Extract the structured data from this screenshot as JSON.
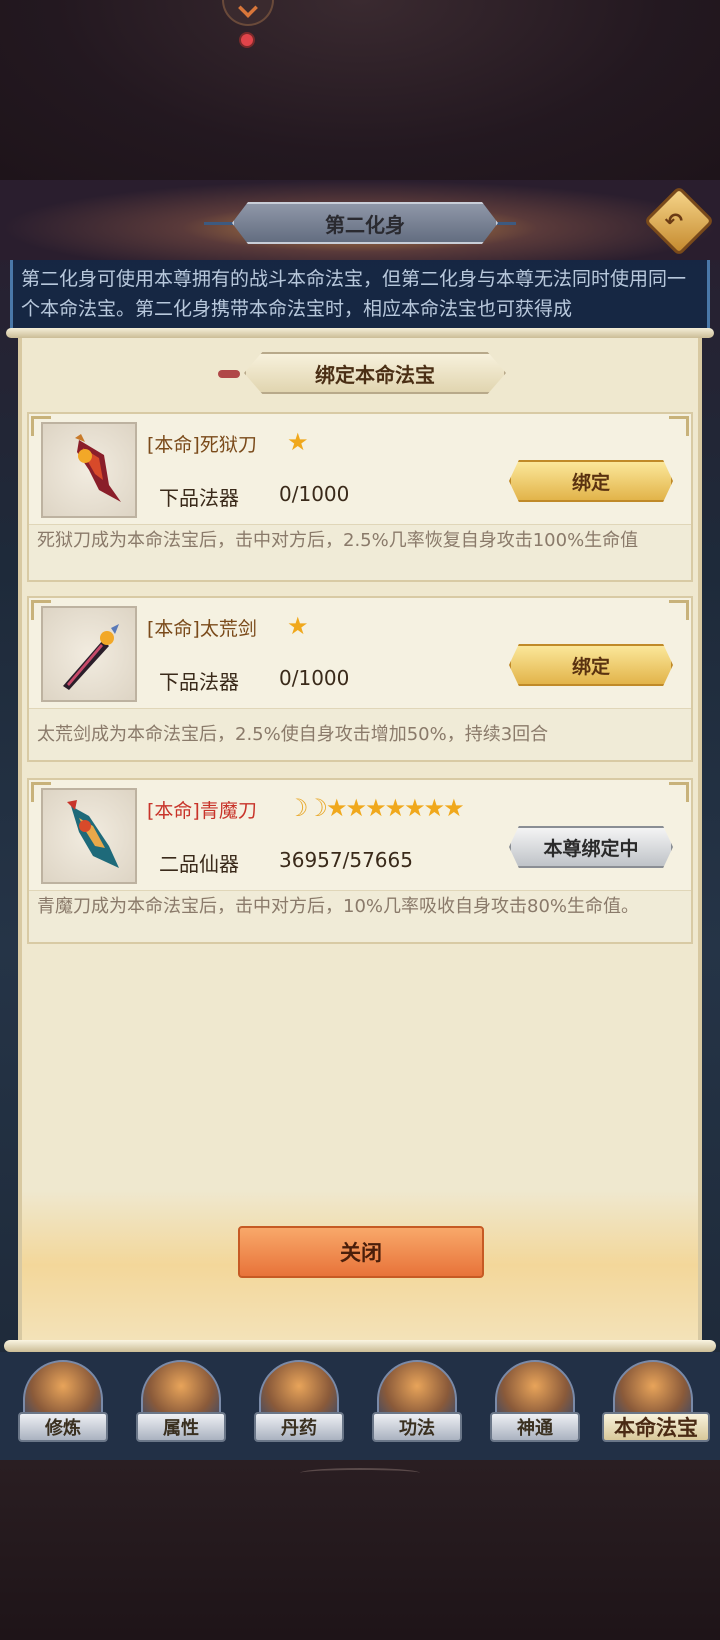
{
  "header": {
    "title": "第二化身"
  },
  "info": {
    "text": "第二化身可使用本尊拥有的战斗本命法宝，但第二化身与本尊无法同时使用同一个本命法宝。第二化身携带本命法宝时，相应本命法宝也可获得成"
  },
  "section": {
    "title": "绑定本命法宝"
  },
  "items": [
    {
      "name": "[本命]死狱刀",
      "stars": "★",
      "grade": "下品法器",
      "progress": "0/1000",
      "button": "绑定",
      "desc": "死狱刀成为本命法宝后，击中对方后，2.5%几率恢复自身攻击100%生命值"
    },
    {
      "name": "[本命]太荒剑",
      "stars": "★",
      "grade": "下品法器",
      "progress": "0/1000",
      "button": "绑定",
      "desc": "太荒剑成为本命法宝后，2.5%使自身攻击增加50%，持续3回合"
    },
    {
      "name": "[本命]青魔刀",
      "moons": "☽☽",
      "stars": "★★★★★★★",
      "grade": "二品仙器",
      "progress": "36957/57665",
      "button": "本尊绑定中",
      "desc": "青魔刀成为本命法宝后，击中对方后，10%几率吸收自身攻击80%生命值。"
    }
  ],
  "close_label": "关闭",
  "nav": [
    "修炼",
    "属性",
    "丹药",
    "功法",
    "神通",
    "本命法宝"
  ],
  "colors": {
    "accent_gold": "#e2b44a",
    "close_orange": "#e8733a",
    "red_name": "#c8342a"
  }
}
